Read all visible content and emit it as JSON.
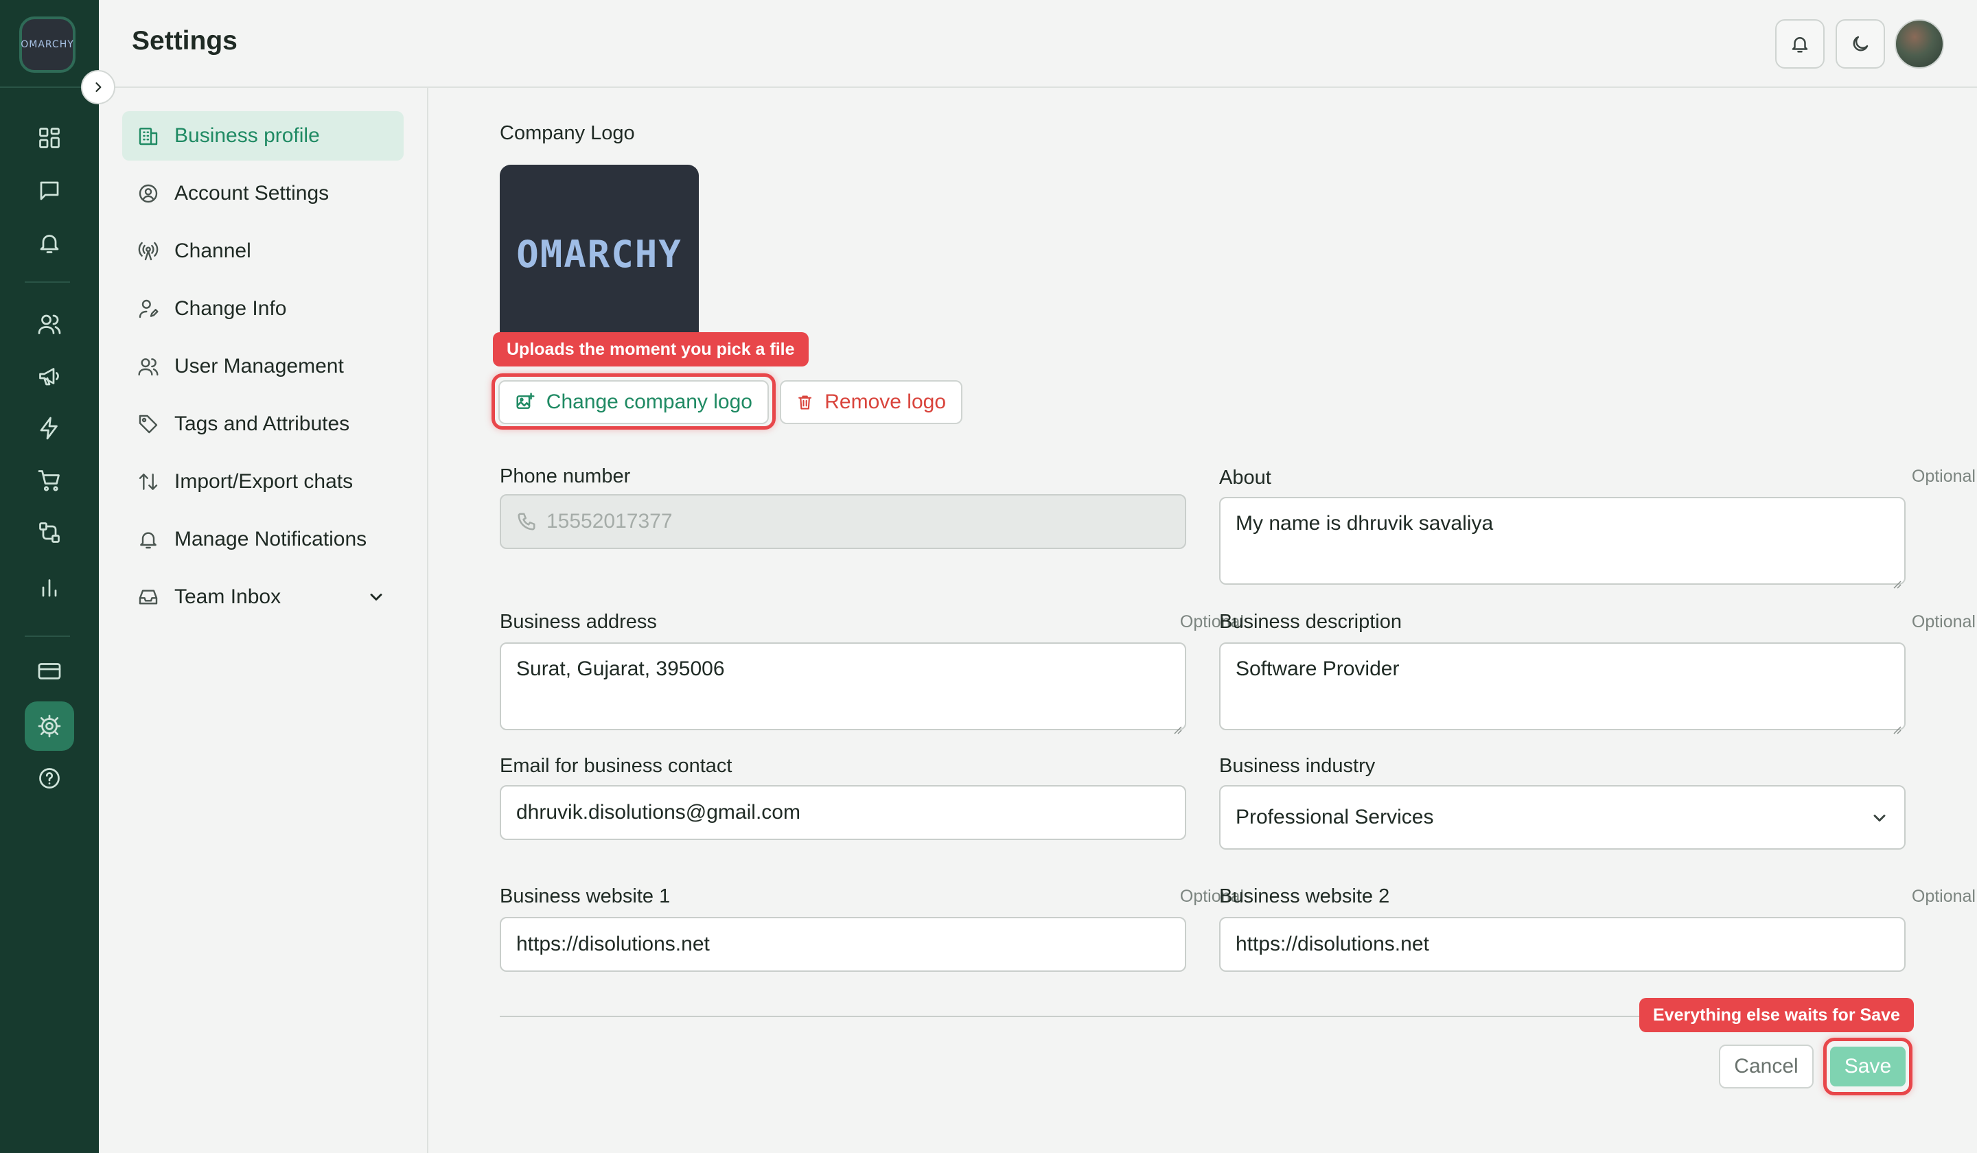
{
  "rail": {
    "logo_text": "OMARCHY",
    "icons": [
      "dashboard-icon",
      "chat-icon",
      "bell-icon",
      "users-icon",
      "megaphone-icon",
      "bolt-icon",
      "cart-icon",
      "flow-icon",
      "bar-chart-icon",
      "billing-icon",
      "settings-icon",
      "help-icon"
    ],
    "active": "settings-icon"
  },
  "header": {
    "title": "Settings",
    "icons": [
      "bell-icon",
      "moon-icon",
      "avatar"
    ]
  },
  "nav": {
    "items": [
      {
        "label": "Business profile",
        "icon": "building-icon",
        "active": true
      },
      {
        "label": "Account Settings",
        "icon": "user-circle-icon"
      },
      {
        "label": "Channel",
        "icon": "broadcast-icon"
      },
      {
        "label": "Change Info",
        "icon": "user-edit-icon"
      },
      {
        "label": "User Management",
        "icon": "users-icon"
      },
      {
        "label": "Tags and Attributes",
        "icon": "tag-icon"
      },
      {
        "label": "Import/Export chats",
        "icon": "sort-arrows-icon"
      },
      {
        "label": "Manage Notifications",
        "icon": "bell-icon"
      },
      {
        "label": "Team Inbox",
        "icon": "inbox-icon",
        "expandable": true
      }
    ]
  },
  "form": {
    "company_logo_label": "Company Logo",
    "logo_text": "OMARCHY",
    "upload_tip": "Uploads the moment you pick a file",
    "change_logo_label": "Change company logo",
    "remove_logo_label": "Remove logo",
    "optional_label": "Optional",
    "phone": {
      "label": "Phone number",
      "value": "15552017377"
    },
    "about": {
      "label": "About",
      "value": "My name is dhruvik savaliya"
    },
    "address": {
      "label": "Business address",
      "value": "Surat, Gujarat, 395006"
    },
    "description": {
      "label": "Business description",
      "value": "Software Provider"
    },
    "email": {
      "label": "Email for business contact",
      "value": "dhruvik.disolutions@gmail.com"
    },
    "industry": {
      "label": "Business industry",
      "value": "Professional Services"
    },
    "website1": {
      "label": "Business website 1",
      "value": "https://disolutions.net"
    },
    "website2": {
      "label": "Business website 2",
      "value": "https://disolutions.net"
    },
    "save_tip": "Everything else waits for Save",
    "cancel_label": "Cancel",
    "save_label": "Save"
  },
  "colors": {
    "rail_bg": "#173a2e",
    "accent": "#1f8a63",
    "danger": "#e8464a",
    "save_button": "#7fd3b1"
  }
}
